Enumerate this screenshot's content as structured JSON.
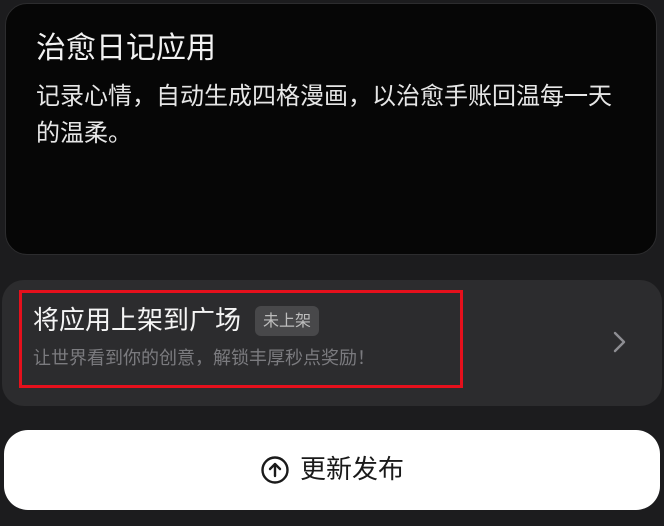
{
  "app": {
    "title": "治愈日记应用",
    "description": "记录心情，自动生成四格漫画，以治愈手账回温每一天的温柔。"
  },
  "publish": {
    "title": "将应用上架到广场",
    "status": "未上架",
    "subtitle": "让世界看到你的创意，解锁丰厚秒点奖励！",
    "chevron_icon": "chevron-right-icon"
  },
  "update_button": {
    "label": "更新发布",
    "icon": "arrow-up-circle-icon"
  },
  "colors": {
    "background": "#1c1c1e",
    "card": "#060606",
    "publish_card": "#2c2c2e",
    "highlight": "#e5101c",
    "button": "#ffffff"
  }
}
